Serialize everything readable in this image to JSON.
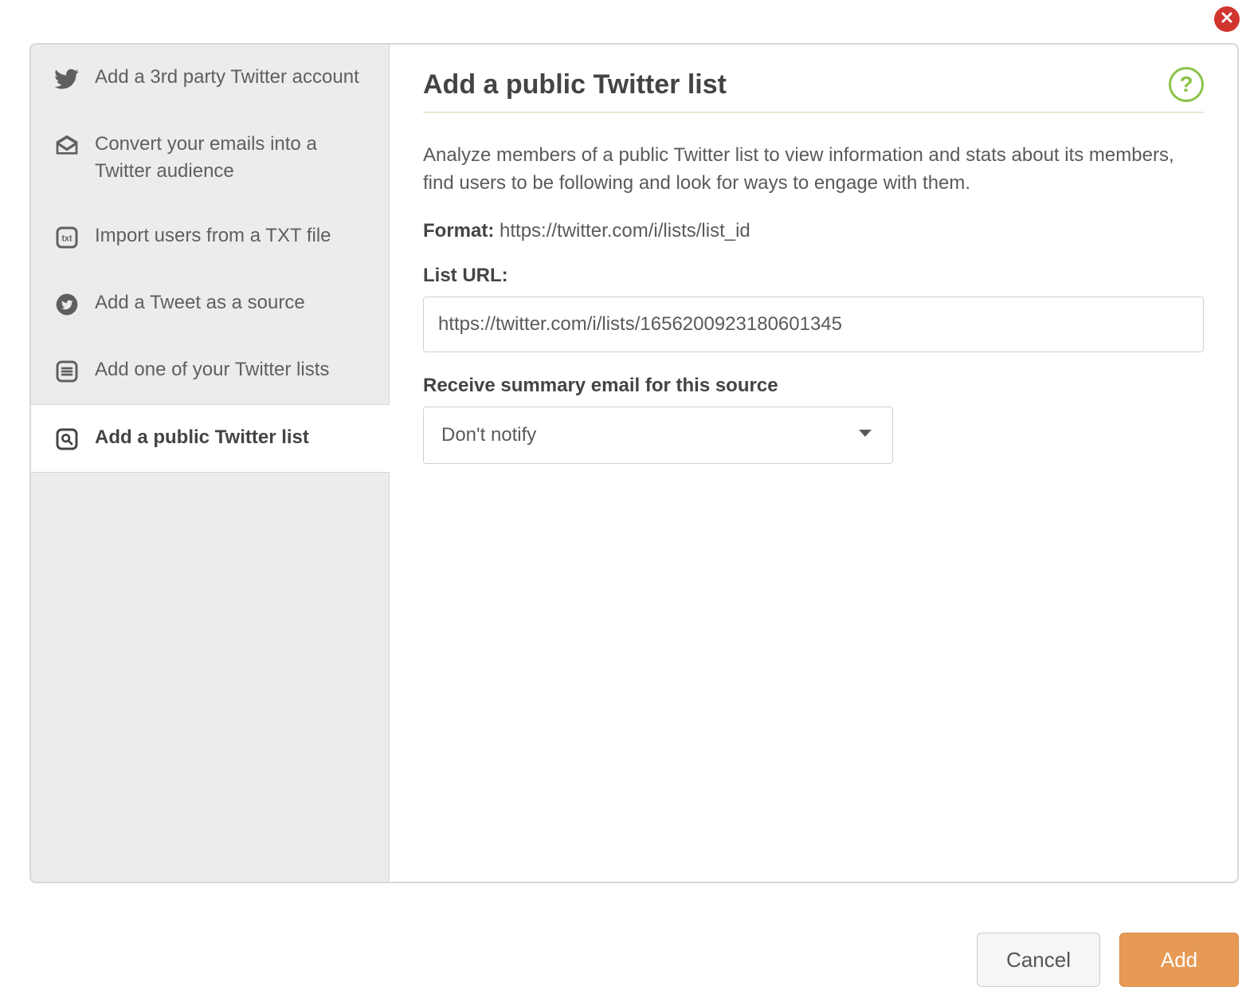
{
  "sidebar": {
    "items": [
      {
        "label": "Add a 3rd party Twitter account",
        "icon": "twitter-icon",
        "active": false
      },
      {
        "label": "Convert your emails into a Twitter audience",
        "icon": "email-icon",
        "active": false
      },
      {
        "label": "Import users from a TXT file",
        "icon": "txt-icon",
        "active": false
      },
      {
        "label": "Add a Tweet as a source",
        "icon": "tweet-circle-icon",
        "active": false
      },
      {
        "label": "Add one of your Twitter lists",
        "icon": "list-icon",
        "active": false
      },
      {
        "label": "Add a public Twitter list",
        "icon": "list-search-icon",
        "active": true
      }
    ]
  },
  "main": {
    "title": "Add a public Twitter list",
    "help_label": "?",
    "description": "Analyze members of a public Twitter list to view information and stats about its members, find users to be following and look for ways to engage with them.",
    "format_label": "Format:",
    "format_value": "https://twitter.com/i/lists/list_id",
    "list_url_label": "List URL:",
    "list_url_value": "https://twitter.com/i/lists/1656200923180601345",
    "summary_label": "Receive summary email for this source",
    "summary_selected": "Don't notify"
  },
  "footer": {
    "cancel": "Cancel",
    "add": "Add"
  }
}
